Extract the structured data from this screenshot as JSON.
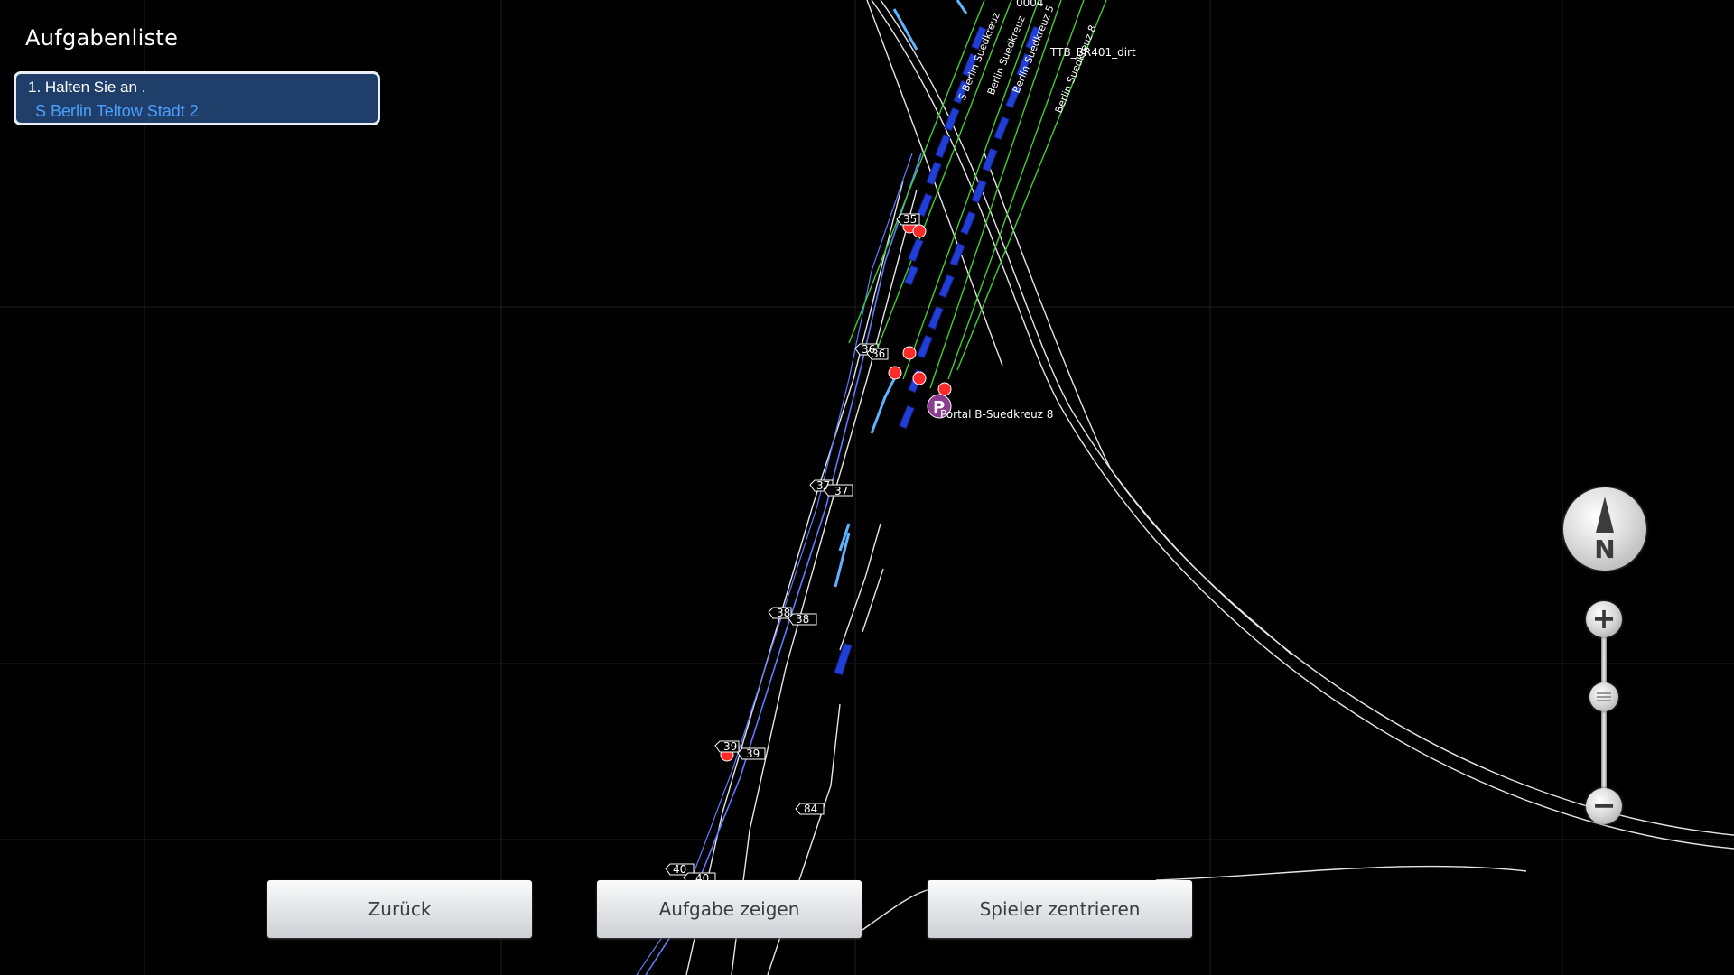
{
  "task_list": {
    "title": "Aufgabenliste",
    "items": [
      {
        "step": "1. Halten Sie an  .",
        "station": "S Berlin Teltow Stadt 2"
      }
    ]
  },
  "map": {
    "portal_icon_letter": "P",
    "portal_label": "Portal B-Suedkreuz 8",
    "track_labels": [
      "TTB_BR401_dirt",
      "0004"
    ],
    "route_labels": [
      "S Berlin Suedkreuz",
      "Berlin Suedkreuz",
      "Berlin Suedkreuz 5",
      "Berlin Suedkreuz 8"
    ],
    "km_markers": [
      "35",
      "36",
      "36",
      "37",
      "37",
      "38",
      "38",
      "39",
      "39",
      "40",
      "40",
      "84"
    ],
    "colors": {
      "background": "#000000",
      "track": "#e6e6e6",
      "route_green": "#3fcf2f",
      "train_blue": "#1f3fd6",
      "signal_red": "#ff2a2a",
      "portal_purple": "#8a3d8f",
      "line_blue": "#5e7bff",
      "line_light_blue": "#5fb4ff"
    }
  },
  "controls": {
    "compass_letter": "N",
    "compass_icon": "north-arrow-icon",
    "zoom_in_symbol": "+",
    "zoom_out_symbol": "−"
  },
  "buttons": {
    "back": "Zurück",
    "show_task": "Aufgabe zeigen",
    "center_player": "Spieler zentrieren"
  }
}
